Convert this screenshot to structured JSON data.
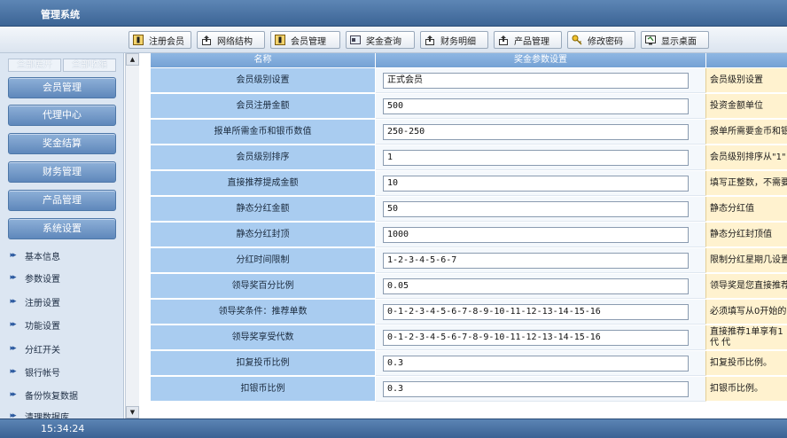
{
  "app": {
    "title": "管理系统"
  },
  "toolbar": {
    "buttons": [
      {
        "label": "注册会员",
        "icon": "member-card-icon"
      },
      {
        "label": "网络结构",
        "icon": "network-upload-icon"
      },
      {
        "label": "会员管理",
        "icon": "member-card-icon"
      },
      {
        "label": "奖金查询",
        "icon": "bonus-query-icon"
      },
      {
        "label": "财务明细",
        "icon": "finance-upload-icon"
      },
      {
        "label": "产品管理",
        "icon": "product-upload-icon"
      },
      {
        "label": "修改密码",
        "icon": "key-icon"
      },
      {
        "label": "显示桌面",
        "icon": "desktop-icon"
      }
    ]
  },
  "sidebar": {
    "expand_all": "全部展开",
    "collapse_all": "全部收缩",
    "categories": [
      "会员管理",
      "代理中心",
      "奖金结算",
      "财务管理",
      "产品管理",
      "系统设置"
    ],
    "items": [
      "基本信息",
      "参数设置",
      "注册设置",
      "功能设置",
      "分红开关",
      "银行帐号",
      "备份恢复数据",
      "清理数据库"
    ]
  },
  "table": {
    "header_name": "名称",
    "header_settings": "奖金参数设置",
    "rows": [
      {
        "label": "会员级别设置",
        "value": "正式会员",
        "desc": "会员级别设置"
      },
      {
        "label": "会员注册金额",
        "value": "500",
        "desc": "投资金额单位"
      },
      {
        "label": "报单所需金币和银币数值",
        "value": "250-250",
        "desc": "报单所需要金币和银"
      },
      {
        "label": "会员级别排序",
        "value": "1",
        "desc": "会员级别排序从\"1\""
      },
      {
        "label": "直接推荐提成金额",
        "value": "10",
        "desc": "填写正整数，不需要"
      },
      {
        "label": "静态分红金额",
        "value": "50",
        "desc": "静态分红值"
      },
      {
        "label": "静态分红封顶",
        "value": "1000",
        "desc": "静态分红封顶值"
      },
      {
        "label": "分红时间限制",
        "value": "1-2-3-4-5-6-7",
        "desc": "限制分红星期几设置"
      },
      {
        "label": "领导奖百分比例",
        "value": "0.05",
        "desc": "领导奖是您直接推荐"
      },
      {
        "label": "领导奖条件：推荐单数",
        "value": "0-1-2-3-4-5-6-7-8-9-10-11-12-13-14-15-16",
        "desc": "必须填写从0开始的"
      },
      {
        "label": "领导奖享受代数",
        "value": "0-1-2-3-4-5-6-7-8-9-10-11-12-13-14-15-16",
        "desc": "直接推荐1单享有1代 代"
      },
      {
        "label": "扣复投币比例",
        "value": "0.3",
        "desc": "扣复投币比例。"
      },
      {
        "label": "扣银币比例",
        "value": "0.3",
        "desc": "扣银币比例。"
      }
    ]
  },
  "status": {
    "clock": "15:34:24"
  }
}
